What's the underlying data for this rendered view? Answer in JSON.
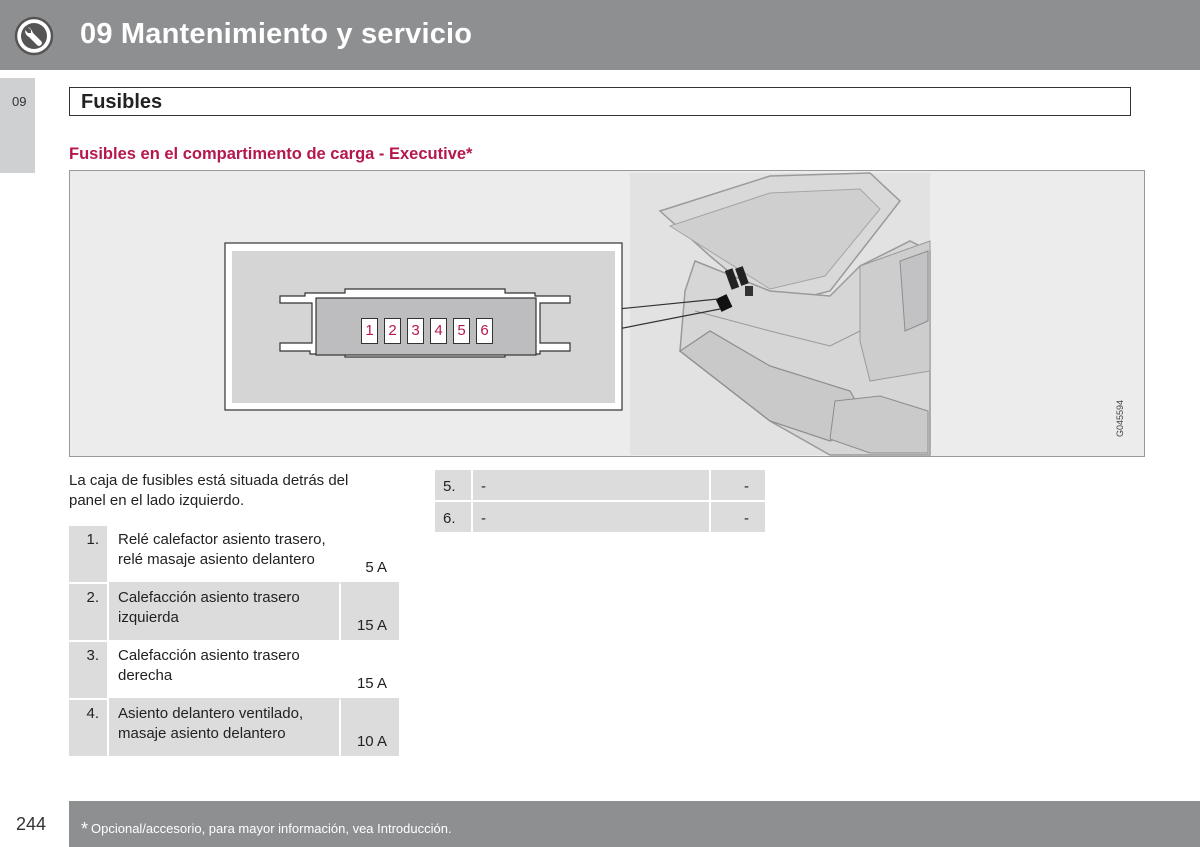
{
  "header": {
    "title": "09 Mantenimiento y servicio",
    "icon": "wrench-icon"
  },
  "side_tab": {
    "label": "09"
  },
  "section": {
    "title": "Fusibles"
  },
  "subheading": "Fusibles en el compartimento de carga - Executive*",
  "figure": {
    "code": "G045594",
    "fuse_labels": [
      "1",
      "2",
      "3",
      "4",
      "5",
      "6"
    ],
    "accent_color": "#b5174f"
  },
  "intro": "La caja de fusibles está situada detrás del panel en el lado izquierdo.",
  "fuses_left": [
    {
      "num": "1.",
      "desc": "Relé calefactor asiento trasero, relé masaje asiento delantero",
      "amp": "5 A"
    },
    {
      "num": "2.",
      "desc": "Calefacción asiento trasero izquierda",
      "amp": "15 A"
    },
    {
      "num": "3.",
      "desc": "Calefacción asiento trasero derecha",
      "amp": "15 A"
    },
    {
      "num": "4.",
      "desc": "Asiento delantero ventilado, masaje asiento delantero",
      "amp": "10 A"
    }
  ],
  "fuses_right": [
    {
      "num": "5.",
      "desc": "-",
      "amp": "-"
    },
    {
      "num": "6.",
      "desc": "-",
      "amp": "-"
    }
  ],
  "footer": {
    "page_number": "244",
    "star": "*",
    "footnote": "Opcional/accesorio, para mayor información, vea Introducción."
  }
}
